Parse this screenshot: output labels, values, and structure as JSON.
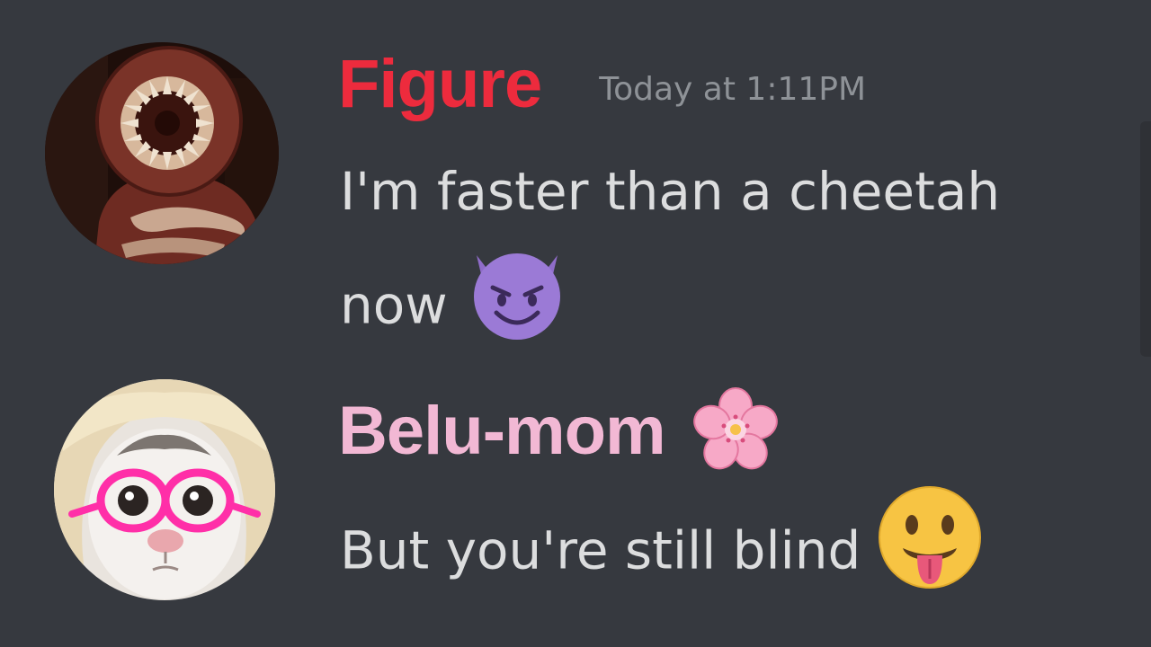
{
  "messages": [
    {
      "username": "Figure",
      "username_color": "#ed2b3d",
      "timestamp": "Today at 1:11PM",
      "text_line_1": "I'm faster than a cheetah",
      "text_line_2": "now",
      "avatar": "figure-monster-avatar",
      "emoji": "smiling-imp-emoji"
    },
    {
      "username": "Belu-mom",
      "username_color": "#f2b8d4",
      "role_icon": "cherry-blossom-icon",
      "text": "But you're still blind",
      "avatar": "cat-with-pink-glasses-avatar",
      "emoji": "face-with-tongue-emoji"
    }
  ],
  "colors": {
    "background": "#36393f",
    "message_text": "#dcddde",
    "timestamp": "#8e9297"
  }
}
